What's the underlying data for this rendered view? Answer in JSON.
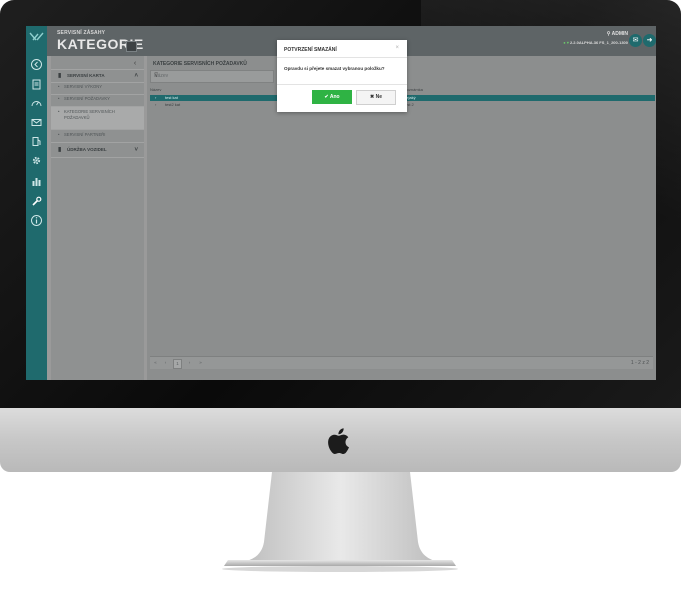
{
  "header": {
    "subtitle": "SERVISNÍ ZÁSAHY",
    "title": "KATEGORIE",
    "user": "ADMIN",
    "status": "2.2.0ALPHA.36 FS_1_200-1300",
    "mail_icon": "envelope-icon",
    "logout_icon": "logout-icon"
  },
  "rail": {
    "icons": [
      "app-logo-icon",
      "back-icon",
      "document-icon",
      "speedometer-icon",
      "mail-icon",
      "fuel-icon",
      "gear-icon",
      "chart-icon",
      "wrench-icon",
      "info-icon"
    ]
  },
  "sidebar": {
    "groups": [
      {
        "label": "SERVISNÍ KARTA",
        "expanded": true
      },
      {
        "label": "ÚDRŽBA VOZIDEL",
        "expanded": false
      }
    ],
    "items": [
      {
        "label": "SERVISNÍ VÝKONY",
        "active": false
      },
      {
        "label": "SERVISNÍ POŽADAVKY",
        "active": false
      },
      {
        "label": "KATEGORIE SERVISNÍCH POŽADAVKŮ",
        "active": true
      },
      {
        "label": "SERVISNÍ PARTNEŘI",
        "active": false
      }
    ]
  },
  "panel": {
    "title": "KATEGORIE SERVISNÍCH POŽADAVKŮ",
    "filter_placeholder": "Název",
    "columns": [
      "Název",
      "Poznámka"
    ],
    "rows": [
      {
        "name": "test kat",
        "note": "nejaký",
        "selected": true
      },
      {
        "name": "test2 kat",
        "note": "test 2",
        "selected": false
      }
    ],
    "pager": {
      "current": "1",
      "count": "1 - 2 z 2"
    }
  },
  "modal": {
    "title": "POTVRZENÍ SMAZÁNÍ",
    "close": "×",
    "message": "Opravdu si přejete smazat vybranou položku?",
    "yes_label": "Ano",
    "no_label": "Ne"
  },
  "colors": {
    "accent": "#1f6a6d",
    "confirm": "#2fb344"
  }
}
